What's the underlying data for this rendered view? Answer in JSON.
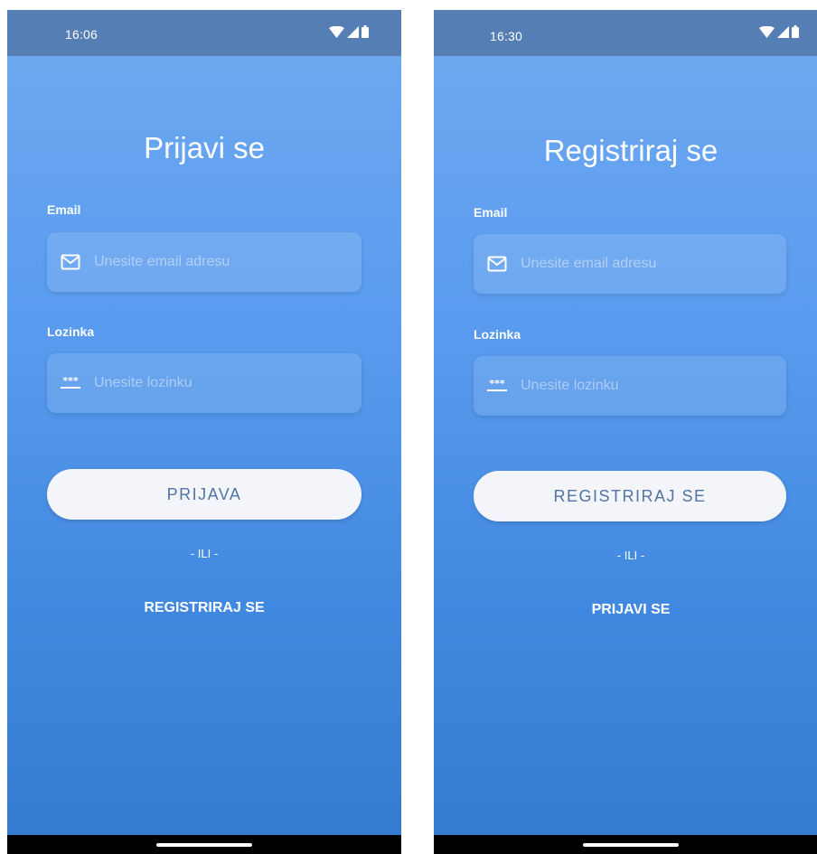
{
  "login": {
    "status_time": "16:06",
    "title": "Prijavi se",
    "email_label": "Email",
    "email_placeholder": "Unesite email adresu",
    "password_label": "Lozinka",
    "password_placeholder": "Unesite lozinku",
    "password_icon_glyph": "***",
    "primary_button": "PRIJAVA",
    "divider": "- ILI -",
    "secondary_link": "REGISTRIRAJ SE"
  },
  "register": {
    "status_time": "16:30",
    "title": "Registriraj se",
    "email_label": "Email",
    "email_placeholder": "Unesite email adresu",
    "password_label": "Lozinka",
    "password_placeholder": "Unesite lozinku",
    "password_icon_glyph": "***",
    "primary_button": "REGISTRIRAJ SE",
    "divider": "- ILI -",
    "secondary_link": "PRIJAVI SE"
  },
  "icons": {
    "status": [
      "wifi-icon",
      "cellular-signal-icon",
      "battery-icon"
    ],
    "email_field": "mail-icon",
    "password_field": "password-dots-icon"
  },
  "colors": {
    "gradient_top": "#70a9f0",
    "gradient_bottom": "#347bd0",
    "status_bar": "#557fb4",
    "button_bg": "#f4f5fa",
    "button_text": "#5174a4"
  }
}
